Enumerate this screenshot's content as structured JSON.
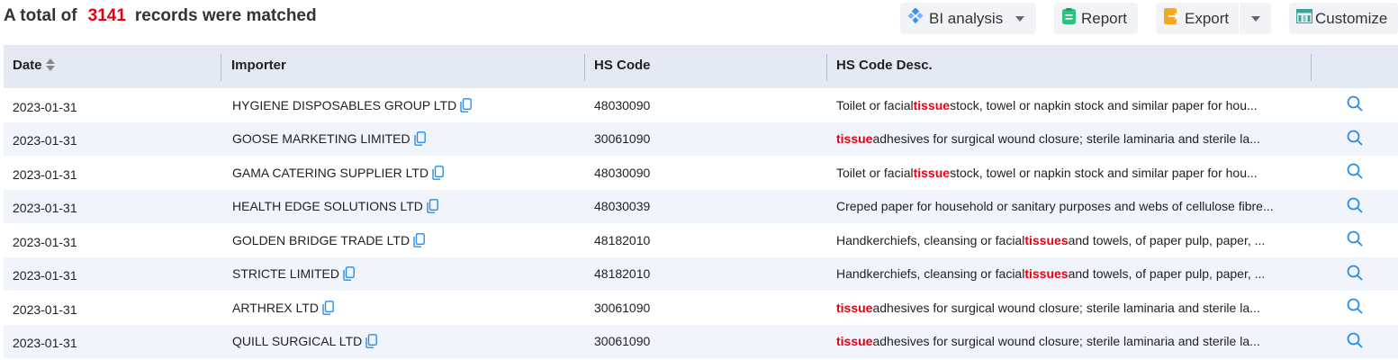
{
  "summary": {
    "prefix": "A total of",
    "count": "3141",
    "suffix": "records were matched"
  },
  "toolbar": {
    "bi_label": "BI analysis",
    "report_label": "Report",
    "export_label": "Export",
    "customize_label": "Customize"
  },
  "table": {
    "headers": {
      "date": "Date",
      "importer": "Importer",
      "hs_code": "HS Code",
      "hs_desc": "HS Code Desc."
    },
    "rows": [
      {
        "date": "2023-01-31",
        "importer": "HYGIENE DISPOSABLES GROUP LTD",
        "hs_code": "48030090",
        "desc_pre": "Toilet or facial ",
        "desc_hl": "tissue",
        "desc_post": " stock, towel or napkin stock and similar paper for hou..."
      },
      {
        "date": "2023-01-31",
        "importer": "GOOSE MARKETING LIMITED",
        "hs_code": "30061090",
        "desc_pre": "",
        "desc_hl": "tissue",
        "desc_post": " adhesives for surgical wound closure; sterile laminaria and sterile la..."
      },
      {
        "date": "2023-01-31",
        "importer": "GAMA CATERING SUPPLIER LTD",
        "hs_code": "48030090",
        "desc_pre": "Toilet or facial ",
        "desc_hl": "tissue",
        "desc_post": " stock, towel or napkin stock and similar paper for hou..."
      },
      {
        "date": "2023-01-31",
        "importer": "HEALTH EDGE SOLUTIONS LTD",
        "hs_code": "48030039",
        "desc_pre": "Creped paper for household or sanitary purposes and webs of cellulose fibre...",
        "desc_hl": "",
        "desc_post": ""
      },
      {
        "date": "2023-01-31",
        "importer": "GOLDEN BRIDGE TRADE LTD",
        "hs_code": "48182010",
        "desc_pre": "Handkerchiefs, cleansing or facial ",
        "desc_hl": "tissues",
        "desc_post": " and towels, of paper pulp, paper, ..."
      },
      {
        "date": "2023-01-31",
        "importer": "STRICTE LIMITED",
        "hs_code": "48182010",
        "desc_pre": "Handkerchiefs, cleansing or facial ",
        "desc_hl": "tissues",
        "desc_post": " and towels, of paper pulp, paper, ..."
      },
      {
        "date": "2023-01-31",
        "importer": "ARTHREX LTD",
        "hs_code": "30061090",
        "desc_pre": "",
        "desc_hl": "tissue",
        "desc_post": " adhesives for surgical wound closure; sterile laminaria and sterile la..."
      },
      {
        "date": "2023-01-31",
        "importer": "QUILL SURGICAL LTD",
        "hs_code": "30061090",
        "desc_pre": "",
        "desc_hl": "tissue",
        "desc_post": " adhesives for surgical wound closure; sterile laminaria and sterile la..."
      }
    ]
  },
  "icons": {
    "bi": "bi-analysis-icon",
    "report": "report-icon",
    "export": "export-icon",
    "customize": "customize-icon",
    "copy": "copy-icon",
    "search": "search-icon",
    "sort": "sort-icon"
  },
  "colors": {
    "highlight": "#e60012",
    "accent": "#1e88e5",
    "header_bg": "#e4e9f4",
    "alt_row_bg": "#f1f4fa",
    "button_bg": "#f1f3f7"
  }
}
